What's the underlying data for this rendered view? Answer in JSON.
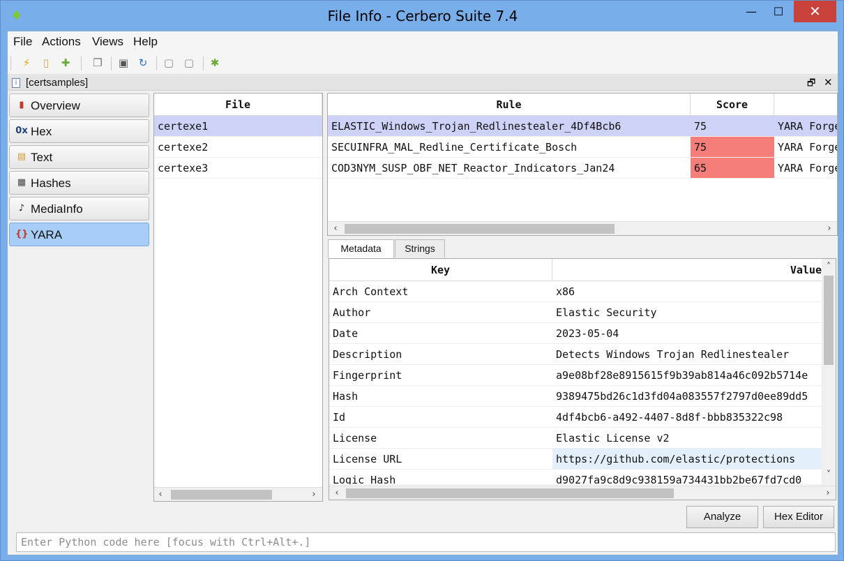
{
  "window": {
    "title": "File Info - Cerbero Suite 7.4",
    "minimize": "—",
    "maximize": "☐",
    "close": "✕"
  },
  "menu": [
    "File",
    "Actions",
    "Views",
    "Help"
  ],
  "document": {
    "title": "[certsamples]",
    "restore": "🗗",
    "close": "✕"
  },
  "nav": [
    {
      "label": "Overview",
      "icon": "bar-chart-icon"
    },
    {
      "label": "Hex",
      "icon": "hex-icon",
      "glyph": "0x"
    },
    {
      "label": "Text",
      "icon": "text-icon"
    },
    {
      "label": "Hashes",
      "icon": "calculator-icon"
    },
    {
      "label": "MediaInfo",
      "icon": "music-note-icon"
    },
    {
      "label": "YARA",
      "icon": "braces-icon",
      "glyph": "{}"
    }
  ],
  "files": {
    "header": "File",
    "rows": [
      "certexe1",
      "certexe2",
      "certexe3"
    ]
  },
  "rules": {
    "headers": {
      "rule": "Rule",
      "score": "Score"
    },
    "rows": [
      {
        "rule": "ELASTIC_Windows_Trojan_Redlinestealer_4Df4Bcb6",
        "score": "75",
        "source": "YARA Forge"
      },
      {
        "rule": "SECUINFRA_MAL_Redline_Certificate_Bosch",
        "score": "75",
        "source": "YARA Forge"
      },
      {
        "rule": "COD3NYM_SUSP_OBF_NET_Reactor_Indicators_Jan24",
        "score": "65",
        "source": "YARA Forge"
      }
    ]
  },
  "tabs": [
    "Metadata",
    "Strings"
  ],
  "metadata": {
    "headers": {
      "key": "Key",
      "value": "Value"
    },
    "rows": [
      {
        "key": "Arch Context",
        "value": "x86"
      },
      {
        "key": "Author",
        "value": "Elastic Security"
      },
      {
        "key": "Date",
        "value": "2023-05-04"
      },
      {
        "key": "Description",
        "value": "Detects Windows Trojan Redlinestealer"
      },
      {
        "key": "Fingerprint",
        "value": "a9e08bf28e8915615f9b39ab814a46c092b5714e"
      },
      {
        "key": "Hash",
        "value": "9389475bd26c1d3fd04a083557f2797d0ee89dd5"
      },
      {
        "key": "Id",
        "value": "4df4bcb6-a492-4407-8d8f-bbb835322c98"
      },
      {
        "key": "License",
        "value": "Elastic License v2"
      },
      {
        "key": "License URL",
        "value": "https://github.com/elastic/protections"
      },
      {
        "key": "Logic Hash",
        "value": "d9027fa9c8d9c938159a734431bb2be67fd7cd0"
      }
    ]
  },
  "buttons": {
    "analyze": "Analyze",
    "hex_editor": "Hex Editor"
  },
  "console": {
    "placeholder": "Enter Python code here [focus with Ctrl+Alt+.]"
  }
}
